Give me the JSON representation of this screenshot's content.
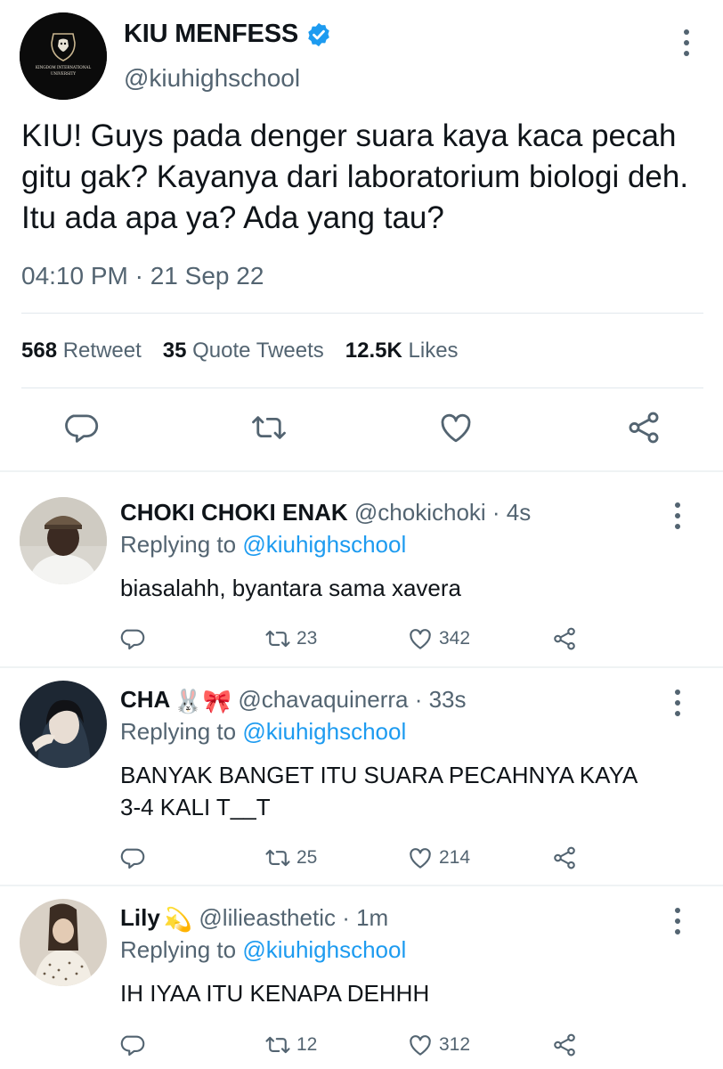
{
  "main_tweet": {
    "author_name": "KIU MENFESS",
    "handle": "@kiuhighschool",
    "avatar_text_line1": "KINGDOM INTERNATIONAL",
    "avatar_text_line2": "UNIVERSITY",
    "text": "KIU! Guys pada denger suara kaya kaca pecah gitu gak? Kayanya dari laboratorium biologi deh. Itu ada apa ya? Ada yang tau?",
    "time": "04:10 PM · 21 Sep 22",
    "retweets_count": "568",
    "retweets_label": "Retweet",
    "quotes_count": "35",
    "quotes_label": "Quote Tweets",
    "likes_count": "12.5K",
    "likes_label": "Likes",
    "icons": [
      "reply-icon",
      "retweet-icon",
      "like-icon",
      "share-icon"
    ]
  },
  "colors": {
    "text": "#0f1419",
    "secondary": "#536471",
    "accent": "#1d9bf0",
    "divider": "#e1e8ed"
  },
  "replies": [
    {
      "name": "CHOKI CHOKI ENAK",
      "emoji": "",
      "handle_time": "@chokichoki · 4s",
      "replying_prefix": "Replying to",
      "replying_to": "@kiuhighschool",
      "text": "biasalahh, byantara sama xavera",
      "retweets": "23",
      "likes": "342"
    },
    {
      "name": "CHA",
      "emoji": "🐰🎀",
      "handle_time": "@chavaquinerra · 33s",
      "replying_prefix": "Replying to",
      "replying_to": "@kiuhighschool",
      "text": "BANYAK BANGET ITU SUARA PECAHNYA KAYA 3-4 KALI T__T",
      "retweets": "25",
      "likes": "214"
    },
    {
      "name": "Lily",
      "emoji": "💫",
      "handle_time": "@lilieasthetic · 1m",
      "replying_prefix": "Replying to",
      "replying_to": "@kiuhighschool",
      "text": "IH IYAA ITU KENAPA DEHHH",
      "retweets": "12",
      "likes": "312"
    }
  ]
}
